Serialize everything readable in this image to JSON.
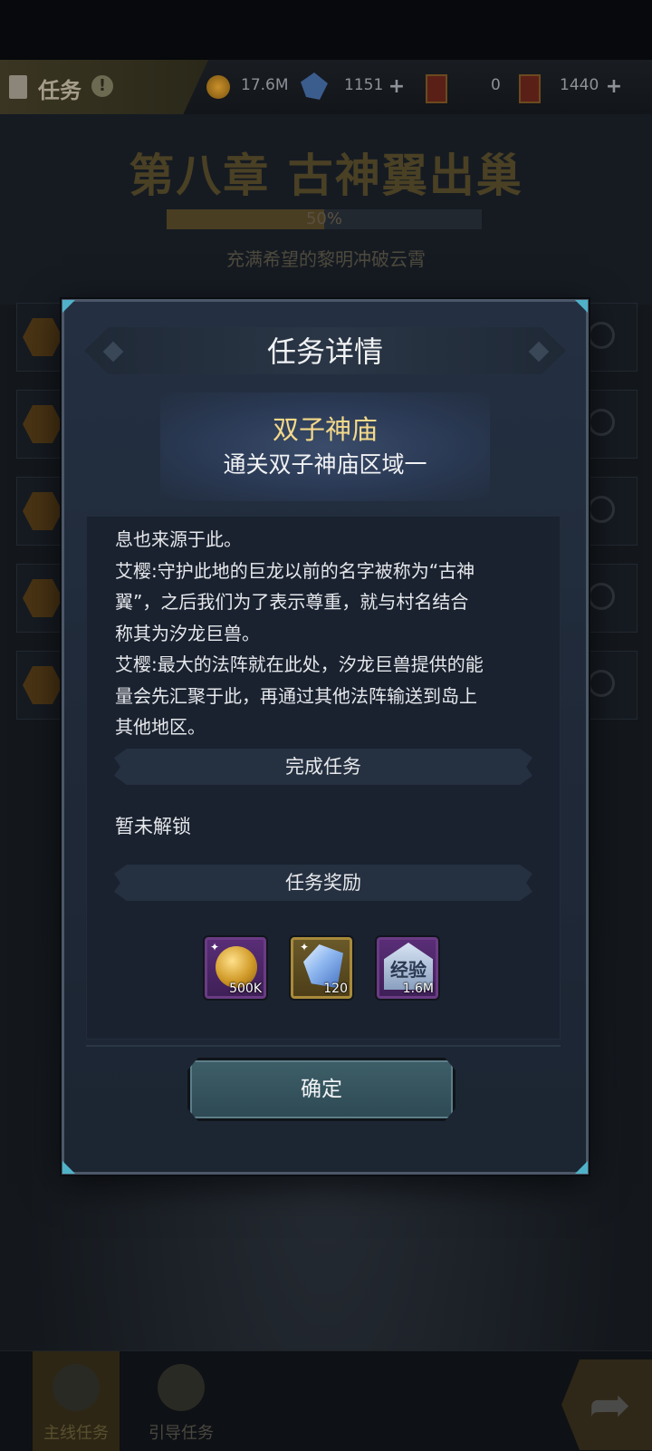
{
  "background": {
    "topbar": {
      "tab_title": "任务",
      "alert_badge": "!",
      "resources": [
        {
          "icon": "gold-coin-icon",
          "value": "17.6M"
        },
        {
          "icon": "crystal-icon",
          "value": "1151",
          "has_plus": true
        },
        {
          "icon": "summon-card-icon",
          "value": "0"
        },
        {
          "icon": "card-icon",
          "value": "1440",
          "has_plus": true
        }
      ]
    },
    "chapter": {
      "title": "第八章 古神翼出巢",
      "progress_label": "50%",
      "progress": 0.5,
      "subtitle": "充满希望的黎明冲破云霄"
    },
    "bottom_nav": {
      "tabs": [
        {
          "label": "主线任务",
          "active": true
        },
        {
          "label": "引导任务",
          "active": false
        }
      ]
    }
  },
  "modal": {
    "title": "任务详情",
    "quest_name": "双子神庙",
    "quest_goal": "通关双子神庙区域一",
    "story_lines": [
      "息也来源于此。",
      "艾樱:守护此地的巨龙以前的名字被称为“古神",
      "翼”，之后我们为了表示尊重，就与村名结合",
      "称其为汐龙巨兽。",
      "艾樱:最大的法阵就在此处，汐龙巨兽提供的能",
      "量会先汇聚于此，再通过其他法阵输送到岛上",
      "其他地区。"
    ],
    "complete_section_label": "完成任务",
    "complete_status": "暂未解锁",
    "reward_section_label": "任务奖励",
    "rewards": [
      {
        "icon": "gold-coin-icon",
        "quantity": "500K"
      },
      {
        "icon": "crystal-icon",
        "quantity": "120"
      },
      {
        "icon": "exp-icon",
        "icon_text": "经验",
        "quantity": "1.6M"
      }
    ],
    "confirm_label": "确定"
  },
  "colors": {
    "quest_name": "#f4d98a",
    "modal_bg": "#1f2938",
    "confirm_button": "#3d5e68"
  }
}
